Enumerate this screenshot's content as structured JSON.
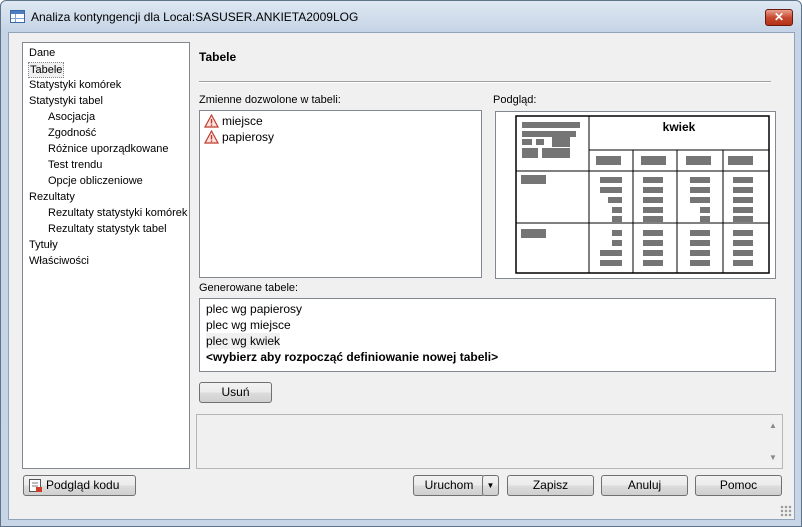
{
  "window": {
    "title": "Analiza kontyngencji dla Local:SASUSER.ANKIETA2009LOG",
    "close_label": "✕"
  },
  "nav": {
    "items": [
      {
        "label": "Dane",
        "level": 0,
        "selected": false
      },
      {
        "label": "Tabele",
        "level": 0,
        "selected": true
      },
      {
        "label": "Statystyki komórek",
        "level": 0,
        "selected": false
      },
      {
        "label": "Statystyki tabel",
        "level": 0,
        "selected": false
      },
      {
        "label": "Asocjacja",
        "level": 1,
        "selected": false
      },
      {
        "label": "Zgodność",
        "level": 1,
        "selected": false
      },
      {
        "label": "Różnice uporządkowane",
        "level": 1,
        "selected": false
      },
      {
        "label": "Test trendu",
        "level": 1,
        "selected": false
      },
      {
        "label": "Opcje obliczeniowe",
        "level": 1,
        "selected": false
      },
      {
        "label": "Rezultaty",
        "level": 0,
        "selected": false
      },
      {
        "label": "Rezultaty statystyki komórek",
        "level": 1,
        "selected": false
      },
      {
        "label": "Rezultaty statystyk tabel",
        "level": 1,
        "selected": false
      },
      {
        "label": "Tytuły",
        "level": 0,
        "selected": false
      },
      {
        "label": "Właściwości",
        "level": 0,
        "selected": false
      }
    ]
  },
  "panel": {
    "title": "Tabele",
    "variables_label": "Zmienne dozwolone w tabeli:",
    "variables": [
      {
        "name": "miejsce",
        "icon": "warning-triangle-icon"
      },
      {
        "name": "papierosy",
        "icon": "warning-triangle-icon"
      }
    ],
    "preview_label": "Podgląd:",
    "preview_header": "kwiek",
    "generated_label": "Generowane tabele:",
    "generated": [
      {
        "text": "plec wg papierosy",
        "style": "normal"
      },
      {
        "text": "plec wg miejsce",
        "style": "normal"
      },
      {
        "text": "plec wg kwiek",
        "style": "highlight"
      },
      {
        "text": "<wybierz aby rozpocząć definiowanie nowej tabeli>",
        "style": "bold"
      }
    ],
    "remove_button": "Usuń"
  },
  "footer": {
    "code_preview_button": "Podgląd kodu",
    "run_button": "Uruchom",
    "run_dropdown_icon": "▼",
    "save_button": "Zapisz",
    "cancel_button": "Anuluj",
    "help_button": "Pomoc"
  },
  "colors": {
    "titlebar": "#c5d4e6",
    "close_button": "#c74a31",
    "preview_block": "#757575",
    "warning_icon": "#c0392b"
  }
}
